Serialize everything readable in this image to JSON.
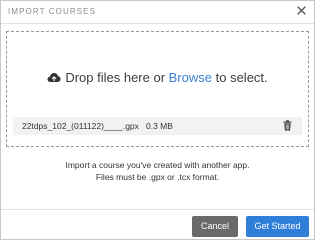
{
  "dialog": {
    "title": "IMPORT COURSES"
  },
  "dropzone": {
    "text_before": "Drop files here or ",
    "browse_link": "Browse",
    "text_after": " to select.",
    "icon": "upload-cloud-icon"
  },
  "file": {
    "name": "22tdps_102_(011122)____.gpx",
    "size": "0.3 MB",
    "delete_icon": "trash-icon"
  },
  "info": {
    "line1": "Import a course you've created with another app.",
    "line2": "Files must be .gpx or .tcx format."
  },
  "footer": {
    "cancel_label": "Cancel",
    "start_label": "Get Started"
  },
  "colors": {
    "accent": "#2f7fd9",
    "link": "#3a7fd5",
    "cancel": "#6a6a6a"
  }
}
